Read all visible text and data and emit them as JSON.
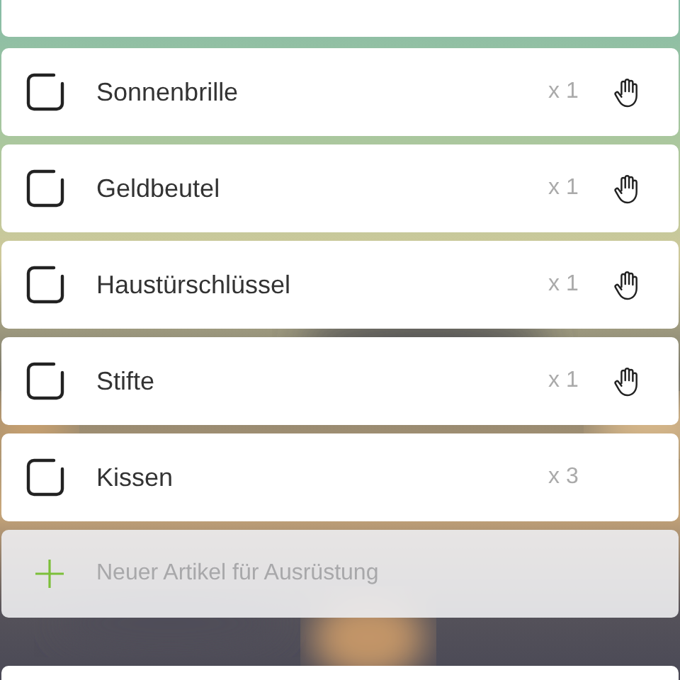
{
  "items": [
    {
      "name": "Sonnenbrille",
      "quantity": "x 1",
      "checked": false,
      "hand_icon": true
    },
    {
      "name": "Geldbeutel",
      "quantity": "x 1",
      "checked": false,
      "hand_icon": true
    },
    {
      "name": "Haustürschlüssel",
      "quantity": "x 1",
      "checked": false,
      "hand_icon": true
    },
    {
      "name": "Stifte",
      "quantity": "x 1",
      "checked": false,
      "hand_icon": true
    },
    {
      "name": "Kissen",
      "quantity": "x 3",
      "checked": false,
      "hand_icon": false
    }
  ],
  "new_item": {
    "placeholder": "Neuer Artikel für Ausrüstung"
  }
}
